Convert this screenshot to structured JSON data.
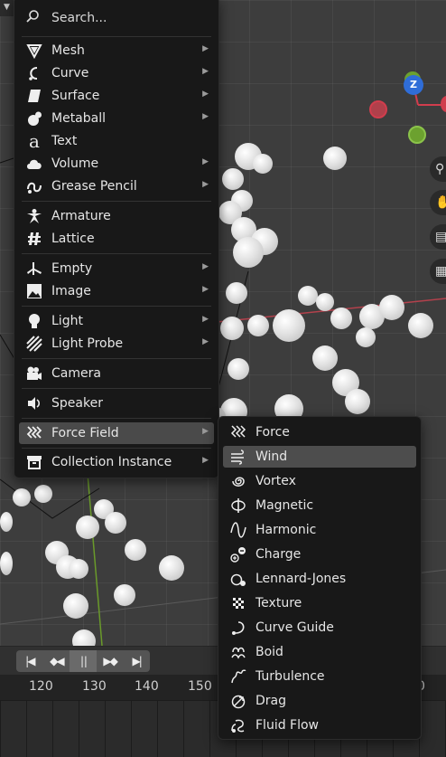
{
  "add_menu": {
    "search_placeholder": "Search...",
    "items": [
      {
        "label": "Mesh",
        "icon": "mesh-icon",
        "submenu": true
      },
      {
        "label": "Curve",
        "icon": "curve-icon",
        "submenu": true
      },
      {
        "label": "Surface",
        "icon": "surface-icon",
        "submenu": true
      },
      {
        "label": "Metaball",
        "icon": "metaball-icon",
        "submenu": true
      },
      {
        "label": "Text",
        "icon": "text-icon",
        "submenu": false
      },
      {
        "label": "Volume",
        "icon": "volume-icon",
        "submenu": true
      },
      {
        "label": "Grease Pencil",
        "icon": "grease-pencil-icon",
        "submenu": true
      },
      {
        "label": "Armature",
        "icon": "armature-icon",
        "submenu": false
      },
      {
        "label": "Lattice",
        "icon": "lattice-icon",
        "submenu": false
      },
      {
        "label": "Empty",
        "icon": "empty-icon",
        "submenu": true
      },
      {
        "label": "Image",
        "icon": "image-icon",
        "submenu": true
      },
      {
        "label": "Light",
        "icon": "light-icon",
        "submenu": true
      },
      {
        "label": "Light Probe",
        "icon": "light-probe-icon",
        "submenu": true
      },
      {
        "label": "Camera",
        "icon": "camera-icon",
        "submenu": false
      },
      {
        "label": "Speaker",
        "icon": "speaker-icon",
        "submenu": false
      },
      {
        "label": "Force Field",
        "icon": "force-field-icon",
        "submenu": true
      },
      {
        "label": "Collection Instance",
        "icon": "collection-instance-icon",
        "submenu": true
      }
    ]
  },
  "force_field_menu": {
    "items": [
      {
        "label": "Force",
        "icon": "force-icon"
      },
      {
        "label": "Wind",
        "icon": "wind-icon"
      },
      {
        "label": "Vortex",
        "icon": "vortex-icon"
      },
      {
        "label": "Magnetic",
        "icon": "magnetic-icon"
      },
      {
        "label": "Harmonic",
        "icon": "harmonic-icon"
      },
      {
        "label": "Charge",
        "icon": "charge-icon"
      },
      {
        "label": "Lennard-Jones",
        "icon": "lennard-jones-icon"
      },
      {
        "label": "Texture",
        "icon": "texture-icon"
      },
      {
        "label": "Curve Guide",
        "icon": "curve-guide-icon"
      },
      {
        "label": "Boid",
        "icon": "boid-icon"
      },
      {
        "label": "Turbulence",
        "icon": "turbulence-icon"
      },
      {
        "label": "Drag",
        "icon": "drag-icon"
      },
      {
        "label": "Fluid Flow",
        "icon": "fluid-flow-icon"
      }
    ],
    "highlighted": "Wind"
  },
  "gizmo": {
    "z_label": "Z"
  },
  "timeline": {
    "frame_ticks": [
      "120",
      "130",
      "140",
      "150",
      "0"
    ],
    "playback_buttons": [
      "jump-to-start-icon",
      "prev-keyframe-icon",
      "pause-icon",
      "next-keyframe-icon",
      "jump-to-end-icon"
    ]
  },
  "colors": {
    "menu_bg": "#181818",
    "highlight": "#4a4a4a",
    "gizmo_x": "#d13d4d",
    "gizmo_y": "#6ca12f",
    "gizmo_z": "#2f6dd8"
  }
}
